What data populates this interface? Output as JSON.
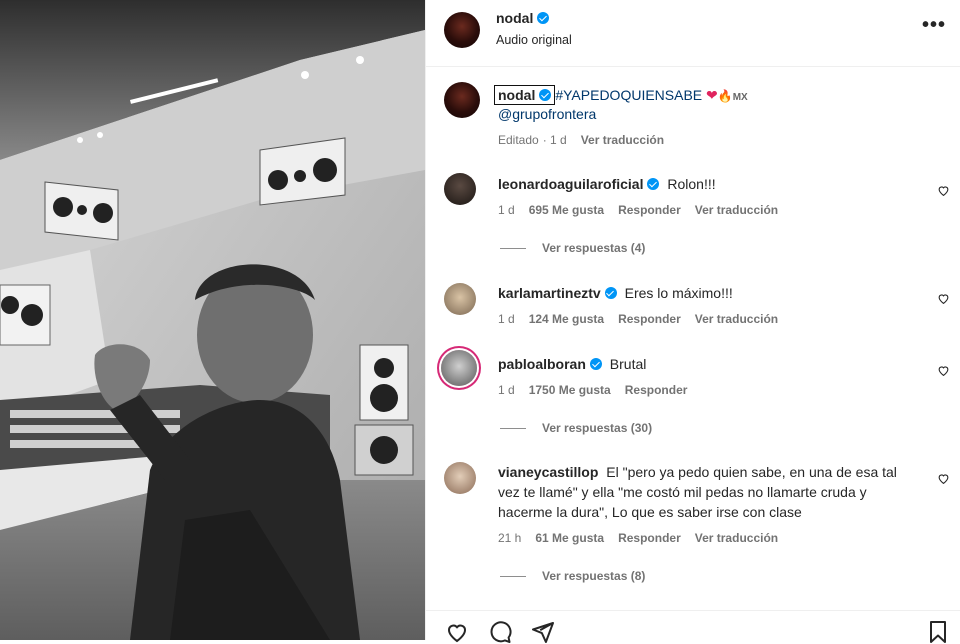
{
  "post": {
    "username": "nodal",
    "audio_label": "Audio original",
    "more_label": "•••"
  },
  "caption": {
    "username": "nodal",
    "hashtag": "#YAPEDOQUIENSABE",
    "emoji_heart": "❤",
    "emoji_fire": "🔥",
    "flag": "MX",
    "mention": "@grupofrontera",
    "edited": "Editado",
    "time": "· 1 d",
    "translate": "Ver traducción"
  },
  "comments": [
    {
      "username": "leonardoaguilaroficial",
      "text": "Rolon!!!",
      "time": "1 d",
      "likes": "695 Me gusta",
      "reply": "Responder",
      "translate": "Ver traducción",
      "replies": "Ver respuestas (4)"
    },
    {
      "username": "karlamartineztv",
      "text": "Eres lo máximo!!!",
      "time": "1 d",
      "likes": "124 Me gusta",
      "reply": "Responder",
      "translate": "Ver traducción"
    },
    {
      "username": "pabloalboran",
      "text": "Brutal",
      "time": "1 d",
      "likes": "1750 Me gusta",
      "reply": "Responder",
      "replies": "Ver respuestas (30)"
    },
    {
      "username": "vianeycastillop",
      "text_line1": "El \"pero ya pedo quien sabe, en una de esa tal",
      "text_line2": "vez te llamé\" y ella \"me costó mil pedas no llamarte cruda y",
      "text_line3": "hacerme la dura\", Lo que es saber irse con clase",
      "time": "21 h",
      "likes": "61 Me gusta",
      "reply": "Responder",
      "translate": "Ver traducción",
      "replies": "Ver respuestas (8)"
    }
  ],
  "colors": {
    "verified": "#0095f6",
    "link": "#00376b",
    "muted": "#737373"
  },
  "icons": [
    "verified-icon",
    "more-icon",
    "heart-icon",
    "comment-icon",
    "share-icon",
    "bookmark-icon"
  ]
}
